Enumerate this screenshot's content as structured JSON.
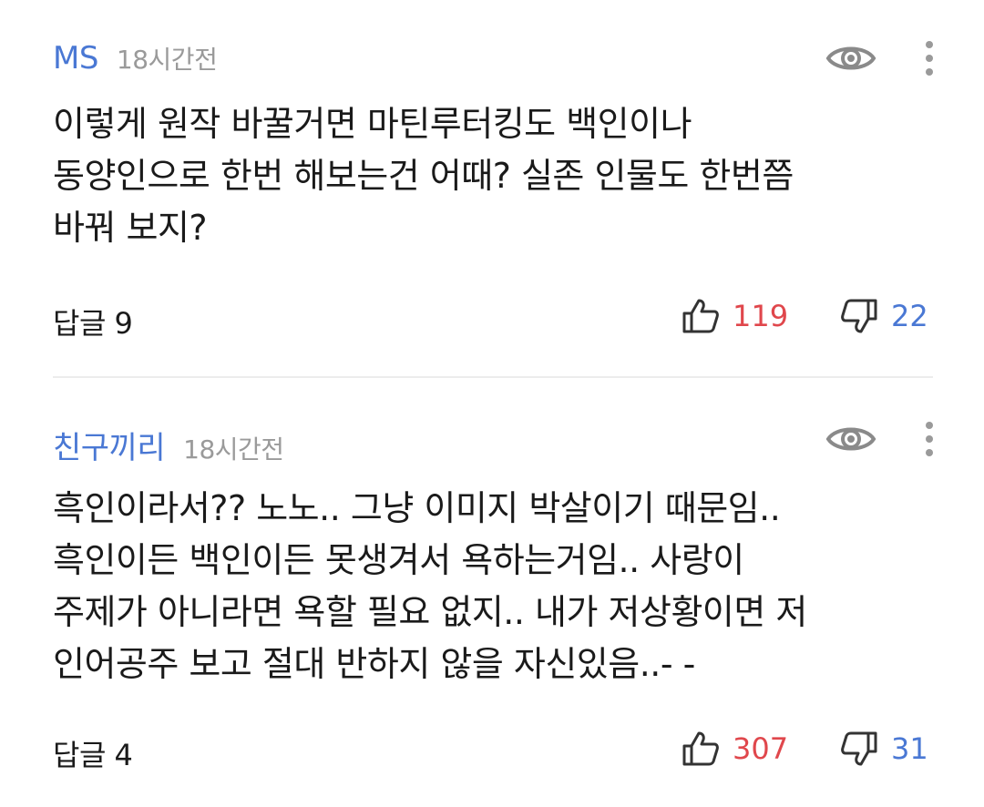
{
  "comments": [
    {
      "username": "MS",
      "time": "18시간전",
      "lines": [
        "이렇게 원작 바꿀거면 마틴루터킹도 백인이나",
        "동양인으로 한번 해보는건 어때? 실존 인물도 한번쯤",
        "바꿔 보지?"
      ],
      "reply_label": "답글 9",
      "likes": "119",
      "dislikes": "22"
    },
    {
      "username": "친구끼리",
      "time": "18시간전",
      "lines": [
        "흑인이라서?? 노노.. 그냥 이미지 박살이기 때문임..",
        "흑인이든 백인이든 못생겨서 욕하는거임..  사랑이",
        "주제가 아니라면 욕할 필요 없지.. 내가 저상황이면 저",
        "인어공주 보고 절대 반하지 않을 자신있음..- -"
      ],
      "reply_label": "답글 4",
      "likes": "307",
      "dislikes": "31"
    }
  ],
  "icons": {
    "view": "eye-icon",
    "menu": "more-vertical-icon",
    "like": "thumbs-up-icon",
    "dislike": "thumbs-down-icon"
  },
  "colors": {
    "username": "#4a78d4",
    "likes": "#e0474c",
    "dislikes": "#4a78d4",
    "time": "#9a9a9a"
  }
}
